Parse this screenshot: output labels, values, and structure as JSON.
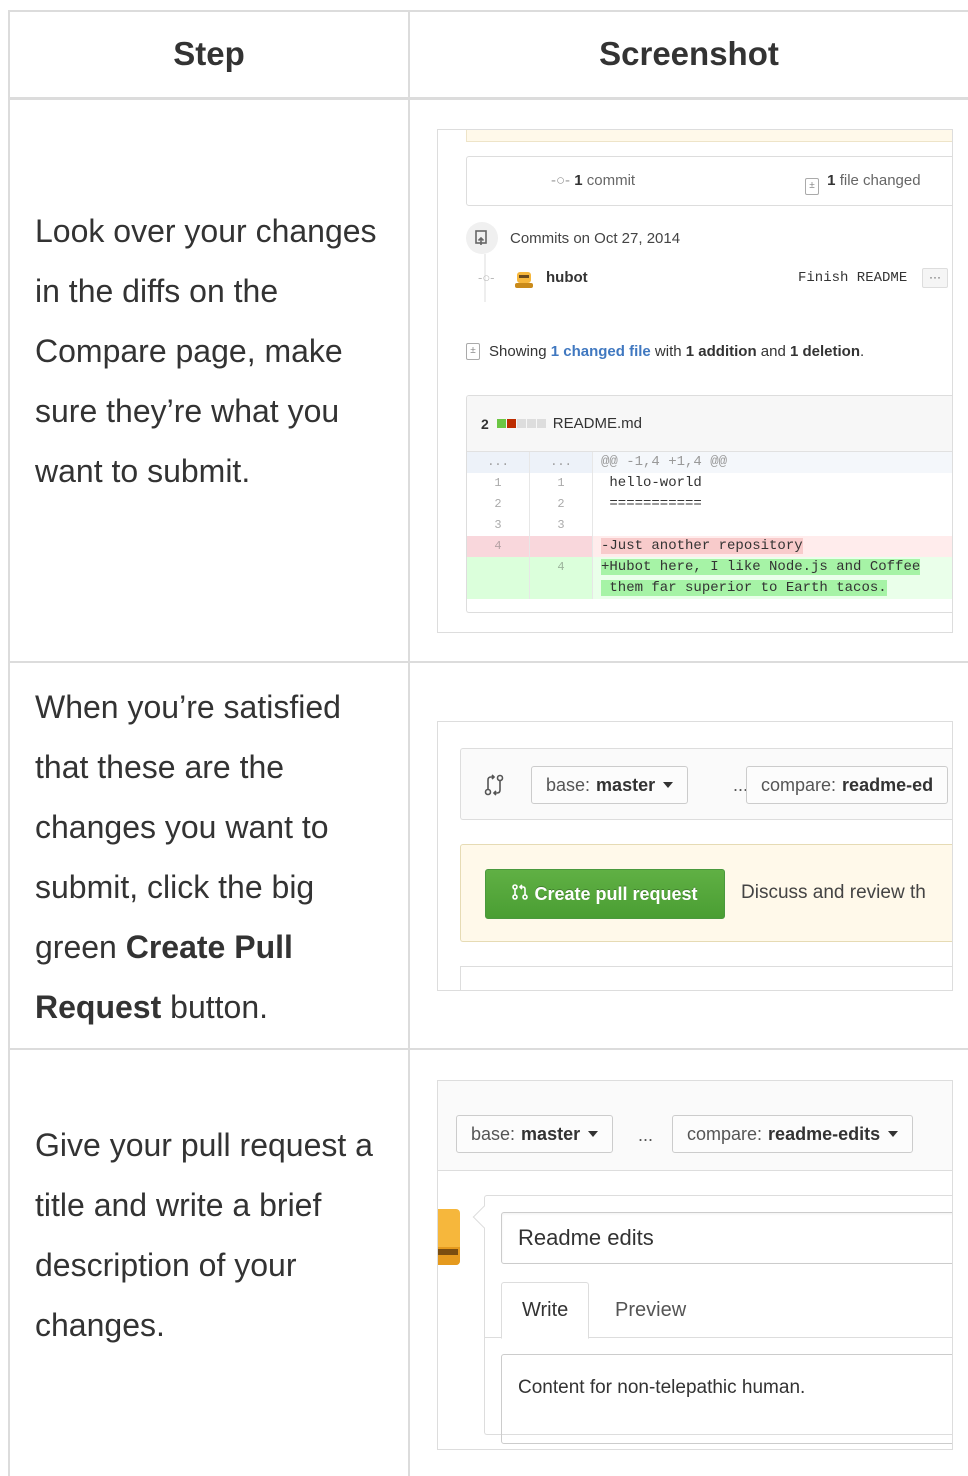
{
  "table": {
    "header_step": "Step",
    "header_screenshot": "Screenshot",
    "rows": [
      {
        "step_text": "Look over your changes in the diffs on the Compare page, make sure they’re what you want to submit."
      },
      {
        "step_text_before": "When you’re satisfied that these are the changes you want to submit, click the big green ",
        "step_text_bold": "Create Pull Request",
        "step_text_after": " button."
      },
      {
        "step_text": "Give your pull request a title and write a brief description of your changes."
      }
    ]
  },
  "compare": {
    "commit_count": "1",
    "commit_label": "commit",
    "files_count": "1",
    "files_label": "file changed",
    "commits_date_label": "Commits on Oct 27, 2014",
    "commit_author": "hubot",
    "commit_message": "Finish README",
    "commit_more": "···",
    "showing_prefix": "Showing",
    "showing_link": "1 changed file",
    "showing_with": "with",
    "showing_additions": "1 addition",
    "showing_and": "and",
    "showing_deletions": "1 deletion",
    "showing_suffix": ".",
    "file_changes": "2",
    "file_name": "README.md",
    "diff": {
      "hunk_left": "...",
      "hunk_right": "...",
      "hunk_text": "@@ -1,4 +1,4 @@",
      "lines": [
        {
          "left": "1",
          "right": "1",
          "text": " hello-world"
        },
        {
          "left": "2",
          "right": "2",
          "text": " ==========="
        },
        {
          "left": "3",
          "right": "3",
          "text": " "
        },
        {
          "left": "4",
          "right": "",
          "text": "-Just another repository"
        },
        {
          "left": "",
          "right": "4",
          "text": "+Hubot here, I like Node.js and Coffee"
        },
        {
          "left": "",
          "right": "",
          "text": " them far superior to Earth tacos."
        }
      ]
    }
  },
  "create": {
    "base_label": "base:",
    "base_value": "master",
    "dots": "...",
    "compare_label": "compare:",
    "compare_value": "readme-ed",
    "button_label": "Create pull request",
    "discuss_text": "Discuss and review th"
  },
  "pr_form": {
    "base_label": "base:",
    "base_value": "master",
    "dots": "...",
    "compare_label": "compare:",
    "compare_value": "readme-edits",
    "title_value": "Readme edits",
    "tab_write": "Write",
    "tab_preview": "Preview",
    "body_value": "Content for non-telepathic human."
  },
  "colors": {
    "green_button": "#55a532",
    "link_blue": "#4078c0",
    "banner_yellow": "#fff9ea",
    "deletion_red": "#bd2c00",
    "addition_green": "#6cc644"
  }
}
